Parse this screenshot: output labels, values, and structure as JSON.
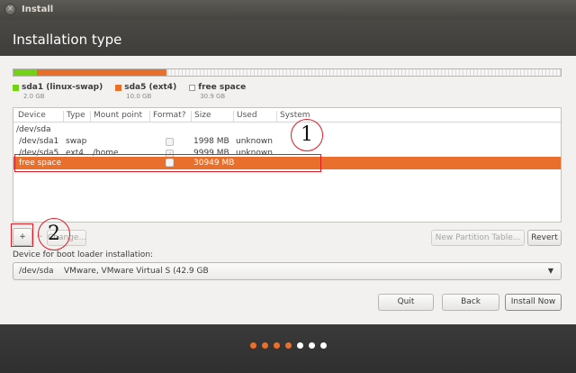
{
  "window": {
    "title": "Install",
    "close_glyph": "×"
  },
  "header": {
    "page_title": "Installation type"
  },
  "partition_bar": {
    "segments": [
      {
        "name": "sda1 (linux-swap)",
        "size": "2.0 GB",
        "color": "#73d216"
      },
      {
        "name": "sda5 (ext4)",
        "size": "10.0 GB",
        "color": "#e96f2c"
      },
      {
        "name": "free space",
        "size": "30.9 GB",
        "color": "#ffffff"
      }
    ]
  },
  "table": {
    "columns": [
      "Device",
      "Type",
      "Mount point",
      "Format?",
      "Size",
      "Used",
      "System"
    ],
    "rows": [
      {
        "device": "/dev/sda",
        "type": "",
        "mount": "",
        "format": "",
        "size": "",
        "used": "",
        "system": ""
      },
      {
        "device": "/dev/sda1",
        "type": "swap",
        "mount": "",
        "format": "unchecked",
        "size": "1998 MB",
        "used": "unknown",
        "system": ""
      },
      {
        "device": "/dev/sda5",
        "type": "ext4",
        "mount": "/home",
        "format": "checked",
        "size": "9999 MB",
        "used": "unknown",
        "system": ""
      },
      {
        "device": "free space",
        "type": "",
        "mount": "",
        "format": "unchecked",
        "size": "30949 MB",
        "used": "",
        "system": ""
      }
    ],
    "selected_row": "free space"
  },
  "annotations": {
    "circle_1": "1",
    "circle_2": "2",
    "color": "#e01b24"
  },
  "toolbar": {
    "add_label": "+",
    "remove_label": "−",
    "change_label": "Change...",
    "new_table_label": "New Partition Table...",
    "revert_label": "Revert"
  },
  "bootloader": {
    "label": "Device for boot loader installation:",
    "device": "/dev/sda",
    "description": "VMware, VMware Virtual S (42.9 GB"
  },
  "actions": {
    "quit": "Quit",
    "back": "Back",
    "install_now": "Install Now"
  },
  "progress": {
    "current_steps": 4,
    "total_steps": 7,
    "done_color": "#e96f2c",
    "todo_color": "#ffffff"
  }
}
